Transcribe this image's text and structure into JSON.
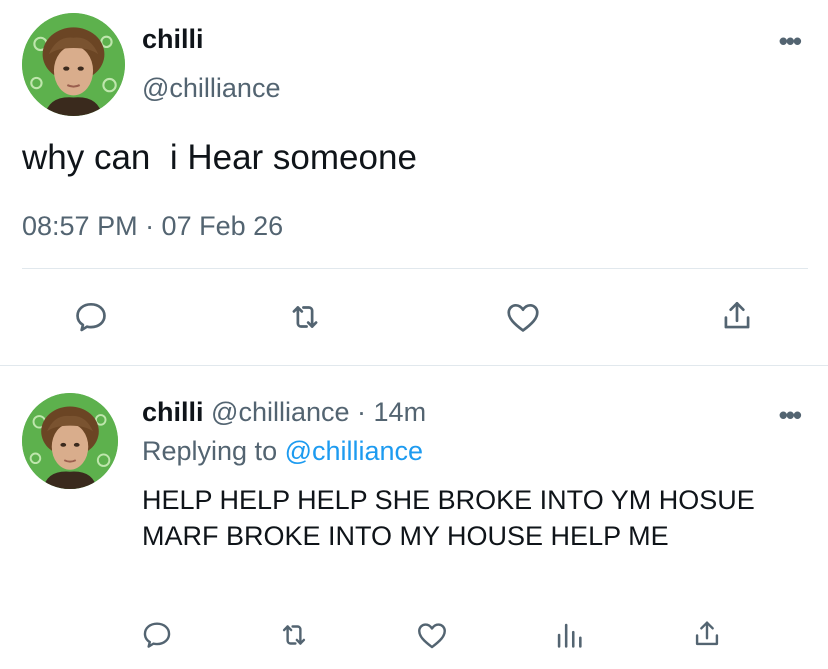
{
  "tweet": {
    "author_name": "chilli",
    "author_handle": "@chilliance",
    "text": "why can  i Hear someone",
    "timestamp": "08:57 PM · 07 Feb 26",
    "more_icon": "more-icon",
    "actions": [
      "reply-icon",
      "retweet-icon",
      "like-icon",
      "share-icon"
    ]
  },
  "reply": {
    "author_name": "chilli",
    "author_handle": "@chilliance",
    "separator": "·",
    "ago": "14m",
    "replying_prefix": "Replying to",
    "replying_to": "@chilliance",
    "text": "HELP HELP HELP SHE BROKE INTO YM HOSUE MARF BROKE INTO MY HOUSE HELP ME",
    "actions": [
      "reply-icon",
      "retweet-icon",
      "like-icon",
      "analytics-icon",
      "share-icon"
    ]
  },
  "colors": {
    "text": "#0f1419",
    "secondary": "#536471",
    "link": "#1d9bf0",
    "divider": "#e1e8ed",
    "avatar_bg": "#58b04a"
  }
}
